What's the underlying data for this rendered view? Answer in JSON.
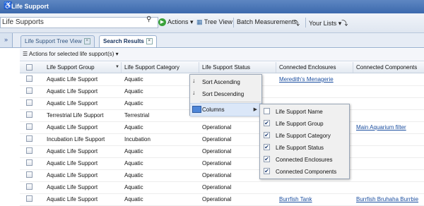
{
  "window": {
    "title": "Life Support",
    "icon": "life-support-icon"
  },
  "toolbar": {
    "search_value": "Life Supports",
    "actions_label": "Actions",
    "tree_view_label": "Tree View",
    "batch_label": "Batch Measurements",
    "lists_label": "Your Lists"
  },
  "tabs": [
    {
      "label": "Life Support Tree View"
    },
    {
      "label": "Search Results"
    }
  ],
  "actions_bar": {
    "label": "Actions for selected life support(s)"
  },
  "grid": {
    "columns": [
      "Life Support Group",
      "Life Support Category",
      "Life Support Status",
      "Connected Enclosures",
      "Connected Components"
    ],
    "rows": [
      {
        "group": "Aquatic Life Support",
        "category": "Aquatic",
        "status": "",
        "enclosures": "Meredith's Menagerie",
        "components": ""
      },
      {
        "group": "Aquatic Life Support",
        "category": "Aquatic",
        "status": "",
        "enclosures": "",
        "components": ""
      },
      {
        "group": "Aquatic Life Support",
        "category": "Aquatic",
        "status": "",
        "enclosures": "",
        "components": ""
      },
      {
        "group": "Terrestrial Life Support",
        "category": "Terrestrial",
        "status": "",
        "enclosures": "",
        "components": ""
      },
      {
        "group": "Aquatic Life Support",
        "category": "Aquatic",
        "status": "Operational",
        "enclosures": "",
        "components": "Main Aquarium filter"
      },
      {
        "group": "Incubation Life Support",
        "category": "Incubation",
        "status": "Operational",
        "enclosures": "",
        "components": ""
      },
      {
        "group": "Aquatic Life Support",
        "category": "Aquatic",
        "status": "Operational",
        "enclosures": "",
        "components": ""
      },
      {
        "group": "Aquatic Life Support",
        "category": "Aquatic",
        "status": "Operational",
        "enclosures": "",
        "components": ""
      },
      {
        "group": "Aquatic Life Support",
        "category": "Aquatic",
        "status": "Operational",
        "enclosures": "",
        "components": ""
      },
      {
        "group": "Aquatic Life Support",
        "category": "Aquatic",
        "status": "Operational",
        "enclosures": "",
        "components": ""
      },
      {
        "group": "Aquatic Life Support",
        "category": "Aquatic",
        "status": "Operational",
        "enclosures": "Burrfish Tank",
        "components": "Burrfish Bruhaha Burrbie"
      }
    ]
  },
  "column_menu": {
    "sort_asc": "Sort Ascending",
    "sort_desc": "Sort Descending",
    "columns": "Columns"
  },
  "columns_submenu": [
    {
      "label": "Life Support Name",
      "checked": false
    },
    {
      "label": "Life Support Group",
      "checked": true
    },
    {
      "label": "Life Support Category",
      "checked": true
    },
    {
      "label": "Life Support Status",
      "checked": true
    },
    {
      "label": "Connected Enclosures",
      "checked": true
    },
    {
      "label": "Connected Components",
      "checked": true
    }
  ]
}
